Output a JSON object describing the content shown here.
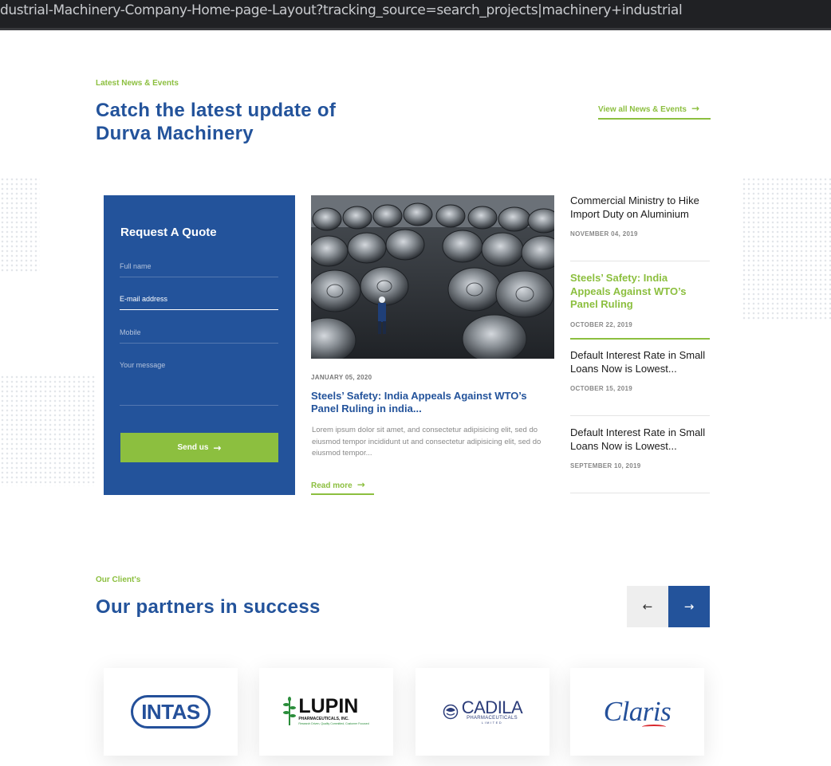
{
  "browser": {
    "url": "dustrial-Machinery-Company-Home-page-Layout?tracking_source=search_projects|machinery+industrial"
  },
  "news_section": {
    "eyebrow": "Latest News & Events",
    "title_line1": "Catch the latest update of",
    "title_line2": "Durva Machinery",
    "view_all_label": "View all News & Events"
  },
  "quote_form": {
    "title": "Request A Quote",
    "fields": [
      {
        "placeholder": "Full name"
      },
      {
        "placeholder": "E-mail address"
      },
      {
        "placeholder": "Mobile"
      },
      {
        "placeholder": "Your message"
      }
    ],
    "submit_label": "Send us"
  },
  "featured_post": {
    "date": "JANUARY 05, 2020",
    "title": "Steels’ Safety: India Appeals Against WTO’s Panel Ruling in india...",
    "excerpt": "Lorem ipsum dolor sit amet, and consectetur adipisicing elit, sed do eiusmod tempor incididunt ut and consectetur adipisicing elit, sed do eiusmod tempor...",
    "read_more_label": "Read more",
    "image_icon": "steel-coils-warehouse-photo"
  },
  "news_list": [
    {
      "title": "Commercial Ministry to Hike Import Duty on Aluminium",
      "date": "NOVEMBER 04, 2019",
      "highlighted": false
    },
    {
      "title": "Steels’ Safety: India Appeals Against WTO’s Panel Ruling",
      "date": "OCTOBER 22, 2019",
      "highlighted": true
    },
    {
      "title": "Default Interest Rate in Small Loans Now is Lowest...",
      "date": "OCTOBER 15, 2019",
      "highlighted": false
    },
    {
      "title": "Default Interest Rate in Small Loans Now is Lowest...",
      "date": "SEPTEMBER 10, 2019",
      "highlighted": false
    }
  ],
  "clients_section": {
    "eyebrow": "Our Client's",
    "title": "Our partners in success",
    "prev_icon": "arrow-left-icon",
    "next_icon": "arrow-right-icon",
    "logos": {
      "intas": "INTAS",
      "lupin": "LUPIN",
      "lupin_sub": "PHARMACEUTICALS, INC.",
      "lupin_tag": "Research Driven, Quality Committed, Customer Focused",
      "cadila": "CADILA",
      "cadila_sub": "PHARMACEUTICALS",
      "cadila_ltd": "LIMITED",
      "claris": "Claris"
    }
  },
  "colors": {
    "brand_blue": "#23539b",
    "accent_green": "#8cbf3f"
  }
}
